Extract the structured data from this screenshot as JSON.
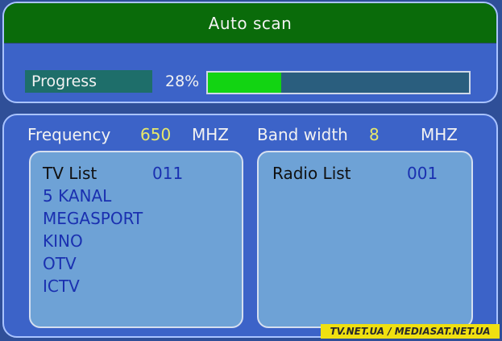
{
  "title": "Auto scan",
  "progress": {
    "label": "Progress",
    "percent_text": "28%",
    "value": 0.28
  },
  "frequency": {
    "label": "Frequency",
    "value": "650",
    "unit": "MHZ"
  },
  "bandwidth": {
    "label": "Band width",
    "value": "8",
    "unit": "MHZ"
  },
  "tv_list": {
    "header": "TV List",
    "count": "011",
    "channels": [
      "5 KANAL",
      "MEGASPORT",
      "KINO",
      "OTV",
      "ICTV"
    ]
  },
  "radio_list": {
    "header": "Radio List",
    "count": "001"
  },
  "watermark": "TV.NET.UA / MEDIASAT.NET.UA",
  "colors": {
    "title_bar": "#0a6b0a",
    "panel": "#3c63c8",
    "progress_fill": "#12d412",
    "value_yellow": "#e8e86a",
    "channel_text": "#1a30b0"
  }
}
